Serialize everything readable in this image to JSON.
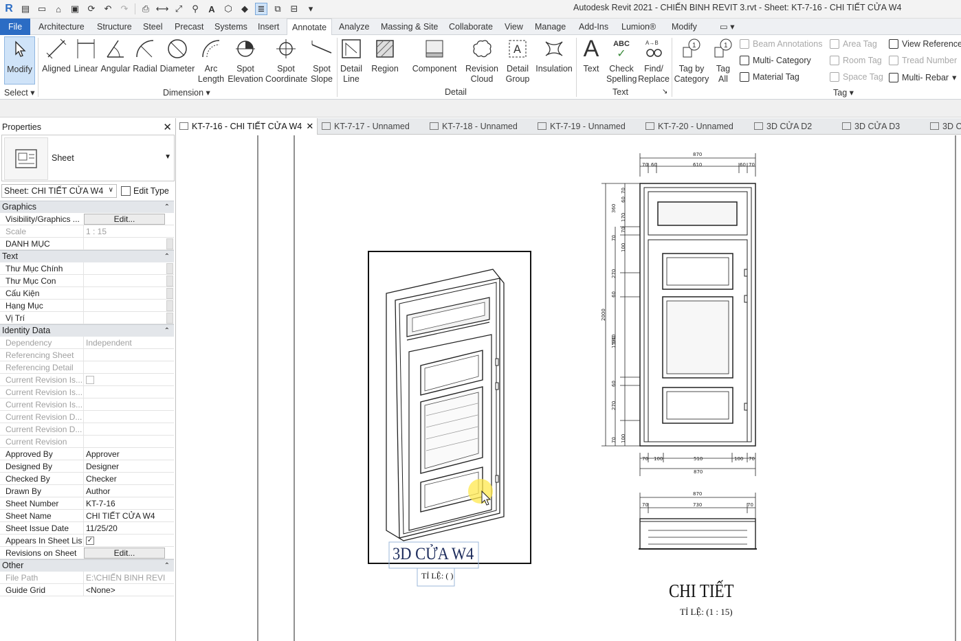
{
  "app": {
    "title": "Autodesk Revit 2021 - CHIẾN BINH REVIT 3.rvt - Sheet: KT-7-16 - CHI TIẾT CỬA W4",
    "logo": "R"
  },
  "ribbon_tabs": [
    "File",
    "Architecture",
    "Structure",
    "Steel",
    "Precast",
    "Systems",
    "Insert",
    "Annotate",
    "Analyze",
    "Massing & Site",
    "Collaborate",
    "View",
    "Manage",
    "Add-Ins",
    "Lumion®",
    "Modify"
  ],
  "active_tab": "Annotate",
  "ribbon": {
    "select": {
      "modify": "Modify",
      "panel": "Select"
    },
    "dimension": {
      "buttons": [
        "Aligned",
        "Linear",
        "Angular",
        "Radial",
        "Diameter",
        "Arc\nLength",
        "Spot\nElevation",
        "Spot\nCoordinate",
        "Spot\nSlope"
      ],
      "panel": "Dimension"
    },
    "detail": {
      "buttons": [
        "Detail\nLine",
        "Region",
        "Component",
        "Revision\nCloud",
        "Detail\nGroup",
        "Insulation"
      ],
      "panel": "Detail"
    },
    "text": {
      "buttons": [
        "Text",
        "Check\nSpelling",
        "Find/\nReplace"
      ],
      "panel": "Text",
      "abc": "ABC"
    },
    "tag": {
      "buttons": [
        "Tag by\nCategory",
        "Tag\nAll"
      ],
      "small": [
        "Beam Annotations",
        "Multi- Category",
        "Material Tag",
        "Area Tag",
        "Room Tag",
        "Space Tag",
        "View Reference",
        "Tread Number",
        "Multi- Rebar"
      ],
      "panel": "Tag"
    }
  },
  "properties": {
    "title": "Properties",
    "type_name": "Sheet",
    "selector": "Sheet: CHI TIẾT CỬA W4",
    "edit_type": "Edit Type",
    "groups": [
      {
        "name": "Graphics",
        "rows": [
          {
            "k": "Visibility/Graphics ...",
            "v": "Edit...",
            "kind": "button"
          },
          {
            "k": "Scale",
            "v": "1 : 15",
            "dim": true
          },
          {
            "k": "DANH MỤC",
            "v": ""
          }
        ]
      },
      {
        "name": "Text",
        "rows": [
          {
            "k": "Thư Mục Chính",
            "v": ""
          },
          {
            "k": "Thư Mục Con",
            "v": ""
          },
          {
            "k": "Cấu Kiện",
            "v": ""
          },
          {
            "k": "Hạng Mục",
            "v": ""
          },
          {
            "k": "Vị Trí",
            "v": ""
          }
        ]
      },
      {
        "name": "Identity Data",
        "rows": [
          {
            "k": "Dependency",
            "v": "Independent",
            "dim": true
          },
          {
            "k": "Referencing Sheet",
            "v": "",
            "dim": true
          },
          {
            "k": "Referencing Detail",
            "v": "",
            "dim": true
          },
          {
            "k": "Current Revision Is...",
            "v": "",
            "dim": true,
            "kind": "checkbox"
          },
          {
            "k": "Current Revision Is...",
            "v": "",
            "dim": true
          },
          {
            "k": "Current Revision Is...",
            "v": "",
            "dim": true
          },
          {
            "k": "Current Revision D...",
            "v": "",
            "dim": true
          },
          {
            "k": "Current Revision D...",
            "v": "",
            "dim": true
          },
          {
            "k": "Current Revision",
            "v": "",
            "dim": true
          },
          {
            "k": "Approved By",
            "v": "Approver"
          },
          {
            "k": "Designed By",
            "v": "Designer"
          },
          {
            "k": "Checked By",
            "v": "Checker"
          },
          {
            "k": "Drawn By",
            "v": "Author"
          },
          {
            "k": "Sheet Number",
            "v": "KT-7-16"
          },
          {
            "k": "Sheet Name",
            "v": "CHI TIẾT CỬA W4"
          },
          {
            "k": "Sheet Issue Date",
            "v": "11/25/20"
          },
          {
            "k": "Appears In Sheet List",
            "v": "✓",
            "kind": "checkbox"
          },
          {
            "k": "Revisions on Sheet",
            "v": "Edit...",
            "kind": "button"
          }
        ]
      },
      {
        "name": "Other",
        "rows": [
          {
            "k": "File Path",
            "v": "E:\\CHIẾN BINH REVI...",
            "dim": true
          },
          {
            "k": "Guide Grid",
            "v": "<None>"
          }
        ]
      }
    ]
  },
  "view_tabs": [
    {
      "label": "KT-7-16 - CHI TIẾT CỬA W4",
      "active": true
    },
    {
      "label": "KT-7-17 - Unnamed"
    },
    {
      "label": "KT-7-18 - Unnamed"
    },
    {
      "label": "KT-7-19 - Unnamed"
    },
    {
      "label": "KT-7-20 - Unnamed"
    },
    {
      "label": "3D CỬA D2"
    },
    {
      "label": "3D CỬA D3"
    },
    {
      "label": "3D C"
    }
  ],
  "sheet": {
    "viewport1": {
      "title": "3D CỬA W4",
      "scale": "TỈ LỆ: ( )"
    },
    "viewport2": {
      "title": "CHI TIẾT",
      "scale": "TỈ LỆ: (1 : 15)"
    },
    "dims_top": [
      "870",
      "70",
      "60",
      "610",
      "60",
      "70"
    ],
    "dims_bottom": [
      "70",
      "100",
      "510",
      "100",
      "70",
      "870"
    ],
    "dims_left_total": "2000",
    "dims_left_mid": "1570",
    "dims_left": [
      "360",
      "70",
      "270",
      "60",
      "640",
      "60",
      "270",
      "70",
      "100",
      "100",
      "70",
      "170",
      "60",
      "70"
    ],
    "dims_section": [
      "870",
      "70",
      "730",
      "70"
    ]
  }
}
